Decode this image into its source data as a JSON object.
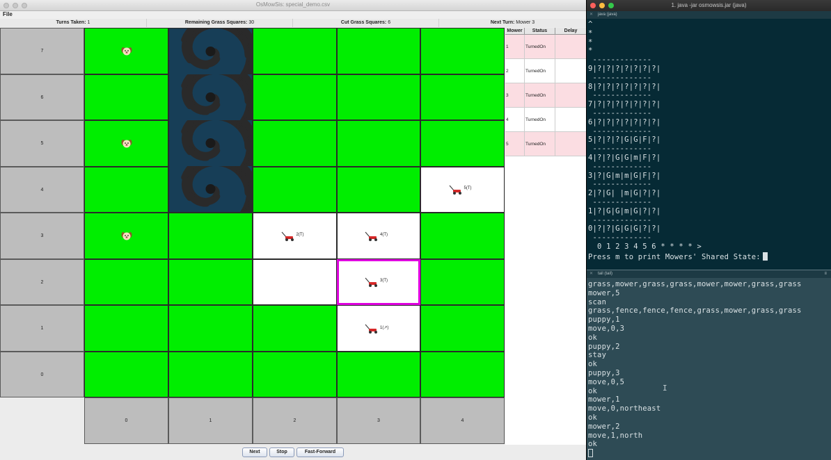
{
  "java_window": {
    "title": "OsMowSis: special_demo.csv",
    "menu": [
      "File"
    ],
    "status": {
      "turns_label": "Turns Taken:",
      "turns_value": "1",
      "remaining_label": "Remaining Grass Squares:",
      "remaining_value": "30",
      "cut_label": "Cut Grass Squares:",
      "cut_value": "6",
      "next_label": "Next Turn:",
      "next_value": "Mower 3"
    },
    "row_labels": [
      "7",
      "6",
      "5",
      "4",
      "3",
      "2",
      "1",
      "0"
    ],
    "col_labels": [
      "0",
      "1",
      "2",
      "3",
      "4"
    ],
    "mowers_on_grid": [
      {
        "label": "5(T)",
        "row": 4,
        "col": 4
      },
      {
        "label": "2(T)",
        "row": 3,
        "col": 2
      },
      {
        "label": "4(T)",
        "row": 3,
        "col": 3
      },
      {
        "label": "3(T)",
        "row": 2,
        "col": 3
      },
      {
        "label": "1(↗)",
        "row": 1,
        "col": 3
      }
    ],
    "mower_table": {
      "headers": [
        "Mower",
        "Status",
        "Delay"
      ],
      "rows": [
        {
          "mower": "1",
          "status": "TurnedOn",
          "delay": ""
        },
        {
          "mower": "2",
          "status": "TurnedOn",
          "delay": ""
        },
        {
          "mower": "3",
          "status": "TurnedOn",
          "delay": ""
        },
        {
          "mower": "4",
          "status": "TurnedOn",
          "delay": ""
        },
        {
          "mower": "5",
          "status": "TurnedOn",
          "delay": ""
        }
      ]
    },
    "buttons": [
      "Next",
      "Stop",
      "Fast-Forward"
    ],
    "colors": {
      "grass": "#00ee00",
      "cut": "#ffffff",
      "crater": "#173e57",
      "selection": "#e000e0"
    },
    "icons": {
      "puppy": "puppy-icon",
      "mower": "mower-icon",
      "crater": "crater-icon"
    }
  },
  "terminal": {
    "title": "1. java -jar osmowsis.jar (java)",
    "top_pane_tab": "java (java)",
    "top_lines": [
      "^",
      "*",
      "*",
      "*",
      " -------------",
      "9|?|?|?|?|?|?|?|",
      " -------------",
      "8|?|?|?|?|?|?|?|",
      " -------------",
      "7|?|?|?|?|?|?|?|",
      " -------------",
      "6|?|?|?|?|?|?|?|",
      " -------------",
      "5|?|?|?|G|G|F|?|",
      " -------------",
      "4|?|?|G|G|m|F|?|",
      " -------------",
      "3|?|G|m|m|G|F|?|",
      " -------------",
      "2|?|G| |m|G|?|?|",
      " -------------",
      "1|?|G|G|m|G|?|?|",
      " -------------",
      "0|?|?|G|G|G|?|?|",
      " -------------",
      "  0 1 2 3 4 5 6 * * * * >"
    ],
    "prompt": "Press m to print Mowers' Shared State:",
    "bottom_pane_tab": "tail (tail)",
    "bottom_lines": [
      "grass,mower,grass,grass,mower,mower,grass,grass",
      "mower,5",
      "scan",
      "grass,fence,fence,fence,grass,mower,grass,grass",
      "puppy,1",
      "move,0,3",
      "ok",
      "puppy,2",
      "stay",
      "ok",
      "puppy,3",
      "move,0,5",
      "ok",
      "mower,1",
      "move,0,northeast",
      "ok",
      "mower,2",
      "move,1,north",
      "ok"
    ]
  }
}
